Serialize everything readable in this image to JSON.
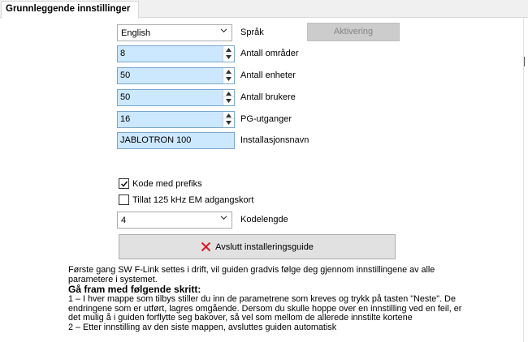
{
  "tab": {
    "label": "Grunnleggende innstillinger"
  },
  "language": {
    "value": "English",
    "label": "Språk",
    "activate_label": "Aktivering"
  },
  "fields": [
    {
      "value": "8",
      "label": "Antall områder"
    },
    {
      "value": "50",
      "label": "Antall enheter"
    },
    {
      "value": "50",
      "label": "Antall brukere"
    },
    {
      "value": "16",
      "label": "PG-utganger"
    }
  ],
  "installation_name": {
    "value": "JABLOTRON 100",
    "label": "Installasjonsnavn"
  },
  "checkboxes": [
    {
      "label": "Kode med prefiks",
      "checked": true
    },
    {
      "label": "Tillat 125 kHz EM adgangskort",
      "checked": false
    }
  ],
  "code_length": {
    "value": "4",
    "label": "Kodelengde"
  },
  "finish_button": {
    "label": "Avslutt installeringsguide",
    "icon": "close-x-icon",
    "icon_color": "#e81123"
  },
  "info": {
    "intro": "Første gang SW F-Link settes i drift, vil guiden gradvis følge deg gjennom innstillingene av alle parametere i systemet.",
    "heading": "Gå fram med følgende skritt:",
    "step1": "1 – I hver mappe som tilbys stiller du inn de parametrene som kreves og trykk på tasten \"Neste\". De endringene som er utført, lagres omgående. Dersom du skulle hoppe over en innstilling ved en feil, er det mulig å i guiden forflytte seg bakover, så vel som mellom de allerede innstilte kortene",
    "step2": "2 – Etter innstilling av den siste mappen, avsluttes guiden automatisk"
  }
}
